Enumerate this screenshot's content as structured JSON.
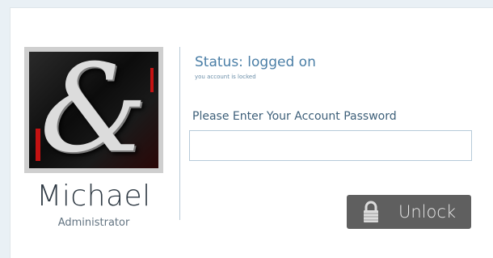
{
  "user": {
    "name": "Michael",
    "role": "Administrator"
  },
  "status": {
    "title": "Status: logged on",
    "subtitle": "you account is locked"
  },
  "password": {
    "prompt": "Please Enter Your Account Password",
    "value": "",
    "placeholder": ""
  },
  "unlock_button": {
    "label": "Unlock",
    "icon": "padlock-icon"
  },
  "colors": {
    "accent": "#4a7ea6",
    "button_bg": "#5f5f5f",
    "page_bg": "#e9f0f5"
  }
}
